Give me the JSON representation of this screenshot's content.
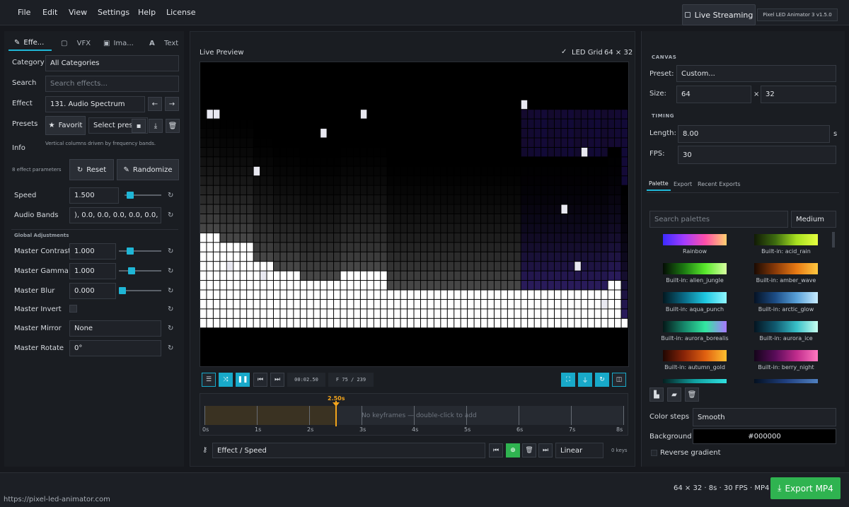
{
  "menu": [
    "File",
    "Edit",
    "View",
    "Settings",
    "Help",
    "License"
  ],
  "header": {
    "live_label": "Live Streaming",
    "version": "Pixel LED Animator 3  v1.5.0"
  },
  "left": {
    "tabs": [
      "Effe...",
      "VFX",
      "Ima...",
      "Text"
    ],
    "category_label": "Category",
    "category_value": "All Categories",
    "search_label": "Search",
    "search_placeholder": "Search effects...",
    "effect_label": "Effect",
    "effect_value": "131. Audio Spectrum",
    "presets_label": "Presets",
    "favorite_label": "Favorit",
    "select_preset": "Select prese",
    "info_label": "Info",
    "info_text": "Vertical columns driven by frequency bands.",
    "param_count": "8 effect parameters",
    "reset_label": "Reset",
    "randomize_label": "Randomize",
    "speed_label": "Speed",
    "speed_value": "1.500",
    "speed_level": 0.08,
    "bands_label": "Audio Bands",
    "bands_value": "), 0.0, 0.0, 0.0, 0.0, 0.0, 0.0]",
    "global_title": "Global Adjustments",
    "contrast_label": "Master Contrast",
    "contrast_value": "1.000",
    "contrast_level": 0.22,
    "gamma_label": "Master Gamma",
    "gamma_value": "1.000",
    "gamma_level": 0.25,
    "blur_label": "Master Blur",
    "blur_value": "0.000",
    "blur_level": 0.0,
    "invert_label": "Master Invert",
    "mirror_label": "Master Mirror",
    "mirror_value": "None",
    "rotate_label": "Master Rotate",
    "rotate_value": "0°"
  },
  "center": {
    "title": "Live Preview",
    "led_grid_label": "LED Grid",
    "grid_size": "64 × 32",
    "timecode": "00:02.50",
    "frame": "F 75 / 239",
    "playhead_label": "2.50s",
    "no_keyframes": "No keyframes — double-click to add",
    "ticks": [
      "0s",
      "1s",
      "2s",
      "3s",
      "4s",
      "5s",
      "6s",
      "7s",
      "8s"
    ],
    "track_value": "Effect / Speed",
    "interp_value": "Linear",
    "keys_count": "0 keys"
  },
  "right": {
    "canvas_title": "CANVAS",
    "preset_label": "Preset:",
    "preset_value": "Custom...",
    "size_label": "Size:",
    "width_value": "64",
    "times": "×",
    "height_value": "32",
    "timing_title": "TIMING",
    "length_label": "Length:",
    "length_value": "8.00",
    "length_unit": "s",
    "fps_label": "FPS:",
    "fps_value": "30",
    "tabs": [
      "Palette",
      "Export",
      "Recent Exports"
    ],
    "palette_search_placeholder": "Search palettes",
    "size_select": "Medium",
    "palettes": [
      {
        "name": "Rainbow",
        "gradient": "linear-gradient(90deg,#3b2bff,#a23cff,#ff4fa8,#ffd070)"
      },
      {
        "name": "Built-in: acid_rain",
        "gradient": "linear-gradient(90deg,#111a05,#3d6b10,#a7e020,#e6ff40)"
      },
      {
        "name": "Built-in: alien_jungle",
        "gradient": "linear-gradient(90deg,#040c04,#1c7a12,#59e82c,#d8ffa0)"
      },
      {
        "name": "Built-in: amber_wave",
        "gradient": "linear-gradient(90deg,#1a0a02,#8a3a08,#e87a14,#ffc840)"
      },
      {
        "name": "Built-in: aqua_punch",
        "gradient": "linear-gradient(90deg,#021820,#0a6a86,#1ec8e0,#8ff6ff)"
      },
      {
        "name": "Built-in: arctic_glow",
        "gradient": "linear-gradient(90deg,#051224,#1c4d86,#58a0d8,#c8ecff)"
      },
      {
        "name": "Built-in: aurora_borealis",
        "gradient": "linear-gradient(90deg,#041818,#16866a,#32e8a0,#a878ff)"
      },
      {
        "name": "Built-in: aurora_ice",
        "gradient": "linear-gradient(90deg,#041420,#105a70,#38c0c8,#c8fff0)"
      },
      {
        "name": "Built-in: autumn_gold",
        "gradient": "linear-gradient(90deg,#200602,#8a2408,#e06010,#ffc030)"
      },
      {
        "name": "Built-in: berry_night",
        "gradient": "linear-gradient(90deg,#14041a,#5a0c5a,#c02c8c,#ff78c0)"
      }
    ],
    "color_steps_label": "Color steps",
    "color_steps_value": "Smooth",
    "background_label": "Background",
    "background_value": "#000000",
    "reverse_label": "Reverse gradient"
  },
  "status": {
    "summary": "64 × 32  ·  8s  ·  30 FPS  ·  MP4",
    "export_label": "Export MP4",
    "url": "https://pixel-led-animator.com"
  },
  "led": {
    "levels": [
      10,
      10,
      10,
      9,
      9,
      9,
      9,
      9,
      7,
      7,
      7,
      6,
      6,
      6,
      6,
      5,
      5,
      5,
      5,
      5,
      5,
      6,
      6,
      6,
      6,
      6,
      6,
      6,
      4,
      4,
      4,
      4,
      4,
      4,
      4,
      4,
      4,
      4,
      4,
      4,
      4,
      4,
      4,
      4,
      4,
      4,
      4,
      4,
      4,
      4,
      4,
      4,
      4,
      4,
      4,
      4,
      4,
      4,
      4,
      4,
      4,
      5,
      5,
      1
    ]
  }
}
